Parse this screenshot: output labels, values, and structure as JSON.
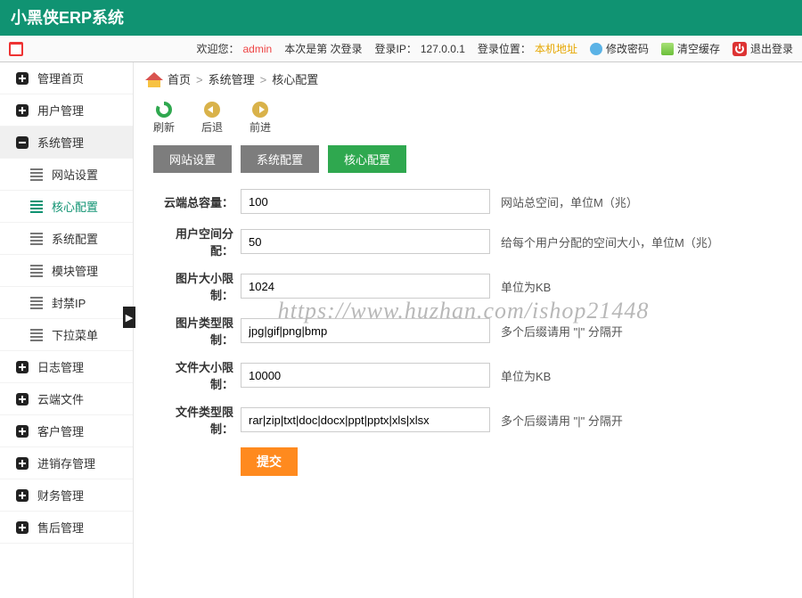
{
  "app_title": "小黑侠ERP系统",
  "status": {
    "welcome": "欢迎您：",
    "user": "admin",
    "login_count": "本次是第    次登录",
    "login_ip_label": "登录IP：",
    "login_ip": "127.0.0.1",
    "login_loc_label": "登录位置：",
    "login_loc": "本机地址",
    "change_pwd": "修改密码",
    "clear_cache": "清空缓存",
    "logout": "退出登录"
  },
  "breadcrumb": {
    "home": "首页",
    "l1": "系统管理",
    "l2": "核心配置"
  },
  "toolbar": {
    "refresh": "刷新",
    "back": "后退",
    "forward": "前进"
  },
  "sidebar": {
    "items": [
      {
        "label": "管理首页",
        "icon": "plus"
      },
      {
        "label": "用户管理",
        "icon": "plus"
      },
      {
        "label": "系统管理",
        "icon": "minus",
        "active": true
      },
      {
        "label": "网站设置",
        "icon": "grid",
        "sub": true
      },
      {
        "label": "核心配置",
        "icon": "grid",
        "sub": true,
        "sel": true
      },
      {
        "label": "系统配置",
        "icon": "grid",
        "sub": true
      },
      {
        "label": "模块管理",
        "icon": "grid",
        "sub": true
      },
      {
        "label": "封禁IP",
        "icon": "grid",
        "sub": true
      },
      {
        "label": "下拉菜单",
        "icon": "grid",
        "sub": true
      },
      {
        "label": "日志管理",
        "icon": "plus"
      },
      {
        "label": "云端文件",
        "icon": "plus"
      },
      {
        "label": "客户管理",
        "icon": "plus"
      },
      {
        "label": "进销存管理",
        "icon": "plus"
      },
      {
        "label": "财务管理",
        "icon": "plus"
      },
      {
        "label": "售后管理",
        "icon": "plus"
      }
    ]
  },
  "tabs": [
    {
      "label": "网站设置"
    },
    {
      "label": "系统配置"
    },
    {
      "label": "核心配置",
      "active": true
    }
  ],
  "form": {
    "rows": [
      {
        "label": "云端总容量：",
        "value": "100",
        "hint": "网站总空间，单位M（兆）"
      },
      {
        "label": "用户空间分配：",
        "value": "50",
        "hint": "给每个用户分配的空间大小，单位M（兆）"
      },
      {
        "label": "图片大小限制：",
        "value": "1024",
        "hint": "单位为KB"
      },
      {
        "label": "图片类型限制：",
        "value": "jpg|gif|png|bmp",
        "hint": "多个后缀请用 \"|\" 分隔开"
      },
      {
        "label": "文件大小限制：",
        "value": "10000",
        "hint": "单位为KB"
      },
      {
        "label": "文件类型限制：",
        "value": "rar|zip|txt|doc|docx|ppt|pptx|xls|xlsx",
        "hint": "多个后缀请用 \"|\" 分隔开"
      }
    ],
    "submit": "提交"
  },
  "watermark": "https://www.huzhan.com/ishop21448"
}
